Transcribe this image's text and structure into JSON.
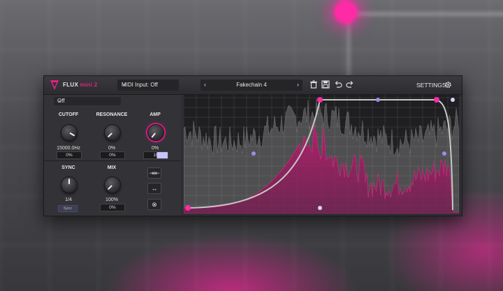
{
  "header": {
    "brand": "FLUX",
    "brand_sub": "mini 2",
    "midi_input": "MIDI Input: Off",
    "preset_name": "Fakechain 4",
    "settings_label": "SETTINGS"
  },
  "lfo_mode": "Off",
  "knobs": {
    "cutoff": {
      "label": "CUTOFF",
      "value": "15000.0Hz",
      "mod": "0%"
    },
    "resonance": {
      "label": "RESONANCE",
      "value": "0%",
      "mod": "0%"
    },
    "amp": {
      "label": "AMP",
      "value": "0%",
      "mod": "10"
    },
    "sync": {
      "label": "SYNC",
      "value": "1/4",
      "mode": "Sync"
    },
    "mix": {
      "label": "MIX",
      "value": "100%",
      "mod": "0%"
    }
  },
  "icons": {
    "trash": "trash-icon",
    "save": "save-icon",
    "undo": "undo-icon",
    "redo": "redo-icon",
    "gear": "gear-icon",
    "arrow_left": "chevron-left-icon",
    "arrow_right": "chevron-right-icon",
    "chevron_down": "chevron-down-icon"
  },
  "colors": {
    "accent": "#e0237f",
    "node_white": "#d8d4ff",
    "curve": "#bdbdbd"
  }
}
